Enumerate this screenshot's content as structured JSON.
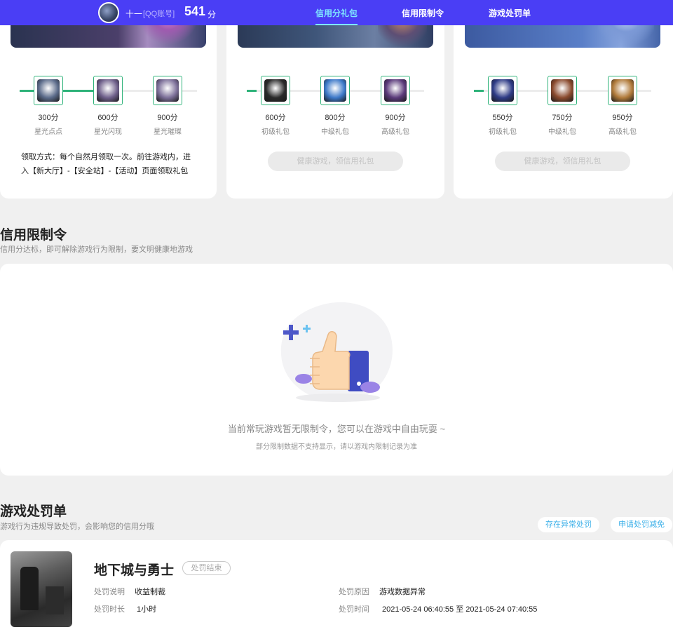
{
  "header": {
    "username": "十一",
    "account_type": "[QQ账号]",
    "score": "541",
    "score_unit": "分",
    "tabs": [
      {
        "label": "信用分礼包",
        "active": true
      },
      {
        "label": "信用限制令",
        "active": false
      },
      {
        "label": "游戏处罚单",
        "active": false
      }
    ]
  },
  "reward_cards": [
    {
      "progress": 0.5,
      "items": [
        {
          "points": "300分",
          "name": "星光点点",
          "color": "#5b6b8a"
        },
        {
          "points": "600分",
          "name": "星光闪现",
          "color": "#6e5f8a"
        },
        {
          "points": "900分",
          "name": "星光璀璨",
          "color": "#7b6e98"
        }
      ],
      "claim_text": "领取方式：每个自然月领取一次。前往游戏内，进入【新大厅】-【安全站】-【活动】页面领取礼包"
    },
    {
      "progress": 0.0,
      "items": [
        {
          "points": "600分",
          "name": "初级礼包",
          "color": "#2a2a2a"
        },
        {
          "points": "800分",
          "name": "中级礼包",
          "color": "#3c78c8"
        },
        {
          "points": "900分",
          "name": "高级礼包",
          "color": "#5a3a7a"
        }
      ],
      "button_label": "健康游戏，领信用礼包"
    },
    {
      "progress": 0.0,
      "items": [
        {
          "points": "550分",
          "name": "初级礼包",
          "color": "#2e3b86"
        },
        {
          "points": "750分",
          "name": "中级礼包",
          "color": "#8a4a2e"
        },
        {
          "points": "950分",
          "name": "高级礼包",
          "color": "#b07a3a"
        }
      ],
      "button_label": "健康游戏，领信用礼包"
    }
  ],
  "restrictions": {
    "title": "信用限制令",
    "subtitle": "信用分达标，即可解除游戏行为限制，要文明健康地游戏",
    "empty_message": "当前常玩游戏暂无限制令，您可以在游戏中自由玩耍 ~",
    "empty_note": "部分限制数据不支持显示，请以游戏内限制记录为准"
  },
  "penalties": {
    "title": "游戏处罚单",
    "subtitle": "游戏行为违规导致处罚，会影响您的信用分哦",
    "appeal_button": "存在异常处罚",
    "reduce_button": "申请处罚减免",
    "record": {
      "game": "地下城与勇士",
      "status": "处罚结束",
      "desc_label": "处罚说明",
      "desc_value": "收益制裁",
      "duration_label": "处罚时长",
      "duration_value": "1小时",
      "reason_label": "处罚原因",
      "reason_value": "游戏数据异常",
      "time_label": "处罚时间",
      "time_value": "2021-05-24 06:40:55 至 2021-05-24 07:40:55"
    }
  },
  "colors": {
    "brand": "#4a3ef5",
    "active_tab": "#7fe6ff",
    "progress": "#2fb37a",
    "link": "#37aee8"
  }
}
